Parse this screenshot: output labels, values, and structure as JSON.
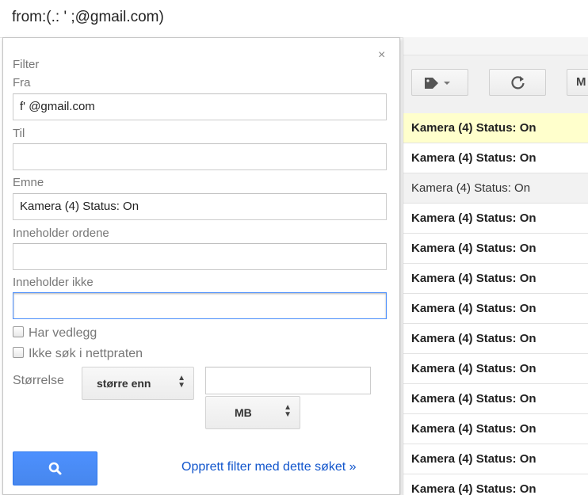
{
  "search": {
    "query": "from:(.:          ' ;@gmail.com)"
  },
  "filter": {
    "title": "Filter",
    "close_glyph": "×",
    "from_label": "Fra",
    "from_value": "f'             @gmail.com",
    "to_label": "Til",
    "to_value": "",
    "subject_label": "Emne",
    "subject_value": "Kamera (4) Status: On",
    "has_words_label": "Inneholder ordene",
    "has_words_value": "",
    "not_words_label": "Inneholder ikke",
    "not_words_value": "",
    "has_attachment_label": "Har vedlegg",
    "no_chats_label": "Ikke søk i nettpraten",
    "size_label": "Størrelse",
    "size_operator": "større enn",
    "size_value": "",
    "size_unit": "MB",
    "create_filter_link": "Opprett filter med dette søket »",
    "search_icon": "search-icon"
  },
  "toolbar": {
    "label_icon": "label-tag-icon",
    "refresh_icon": "refresh-icon",
    "more_label": "M"
  },
  "mail_rows": [
    {
      "subject": "Kamera (4) Status: On",
      "state": "selected"
    },
    {
      "subject": "Kamera (4) Status: On",
      "state": "unread"
    },
    {
      "subject": "Kamera (4) Status: On",
      "state": "read"
    },
    {
      "subject": "Kamera (4) Status: On",
      "state": "unread"
    },
    {
      "subject": "Kamera (4) Status: On",
      "state": "unread"
    },
    {
      "subject": "Kamera (4) Status: On",
      "state": "unread"
    },
    {
      "subject": "Kamera (4) Status: On",
      "state": "unread"
    },
    {
      "subject": "Kamera (4) Status: On",
      "state": "unread"
    },
    {
      "subject": "Kamera (4) Status: On",
      "state": "unread"
    },
    {
      "subject": "Kamera (4) Status: On",
      "state": "unread"
    },
    {
      "subject": "Kamera (4) Status: On",
      "state": "unread"
    },
    {
      "subject": "Kamera (4) Status: On",
      "state": "unread"
    },
    {
      "subject": "Kamera (4) Status: On",
      "state": "unread"
    }
  ],
  "colors": {
    "accent_blue": "#4d90fe",
    "link_blue": "#1155cc",
    "selected_row": "#ffffcc"
  }
}
